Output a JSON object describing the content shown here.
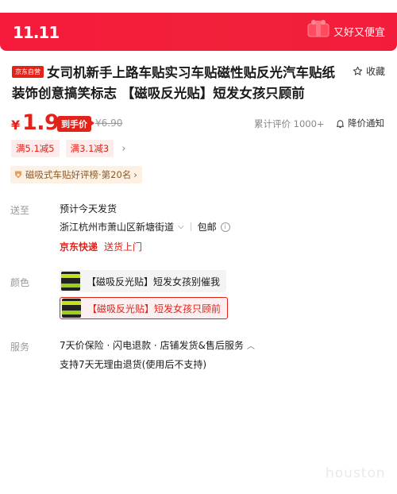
{
  "banner": {
    "logo": "11.11",
    "slogan": "又好又便宜",
    "bg_color": "#f5193a"
  },
  "product": {
    "self_tag": "京东自营",
    "title": "女司机新手上路车贴实习车贴磁性贴反光汽车贴纸装饰创意搞笑标志 【磁吸反光贴】短发女孩只顾前",
    "favorite_label": "收藏"
  },
  "price": {
    "symbol": "¥",
    "value": "1.9",
    "badge": "到手价",
    "original": "¥6.90",
    "reviews": "累计评价 1000+",
    "alert_label": "降价通知",
    "accent_color": "#e2231a"
  },
  "coupons": [
    "满5.1减5",
    "满3.1减3"
  ],
  "rank": {
    "text": "磁吸式车贴好评榜·第20名"
  },
  "shipping": {
    "label": "送至",
    "eta": "预计今天发货",
    "address": "浙江杭州市萧山区新塘街道",
    "free_shipping": "包邮",
    "carrier": "京东快递",
    "door_delivery": "送货上门"
  },
  "color": {
    "label": "颜色",
    "options": [
      "【磁吸反光贴】短发女孩别催我",
      "【磁吸反光贴】短发女孩只顾前"
    ],
    "selected_index": 1
  },
  "service": {
    "label": "服务",
    "items": "7天价保险 · 闪电退款 · 店铺发货&售后服务",
    "return_policy": "支持7天无理由退货(使用后不支持)"
  },
  "watermark": "houston"
}
